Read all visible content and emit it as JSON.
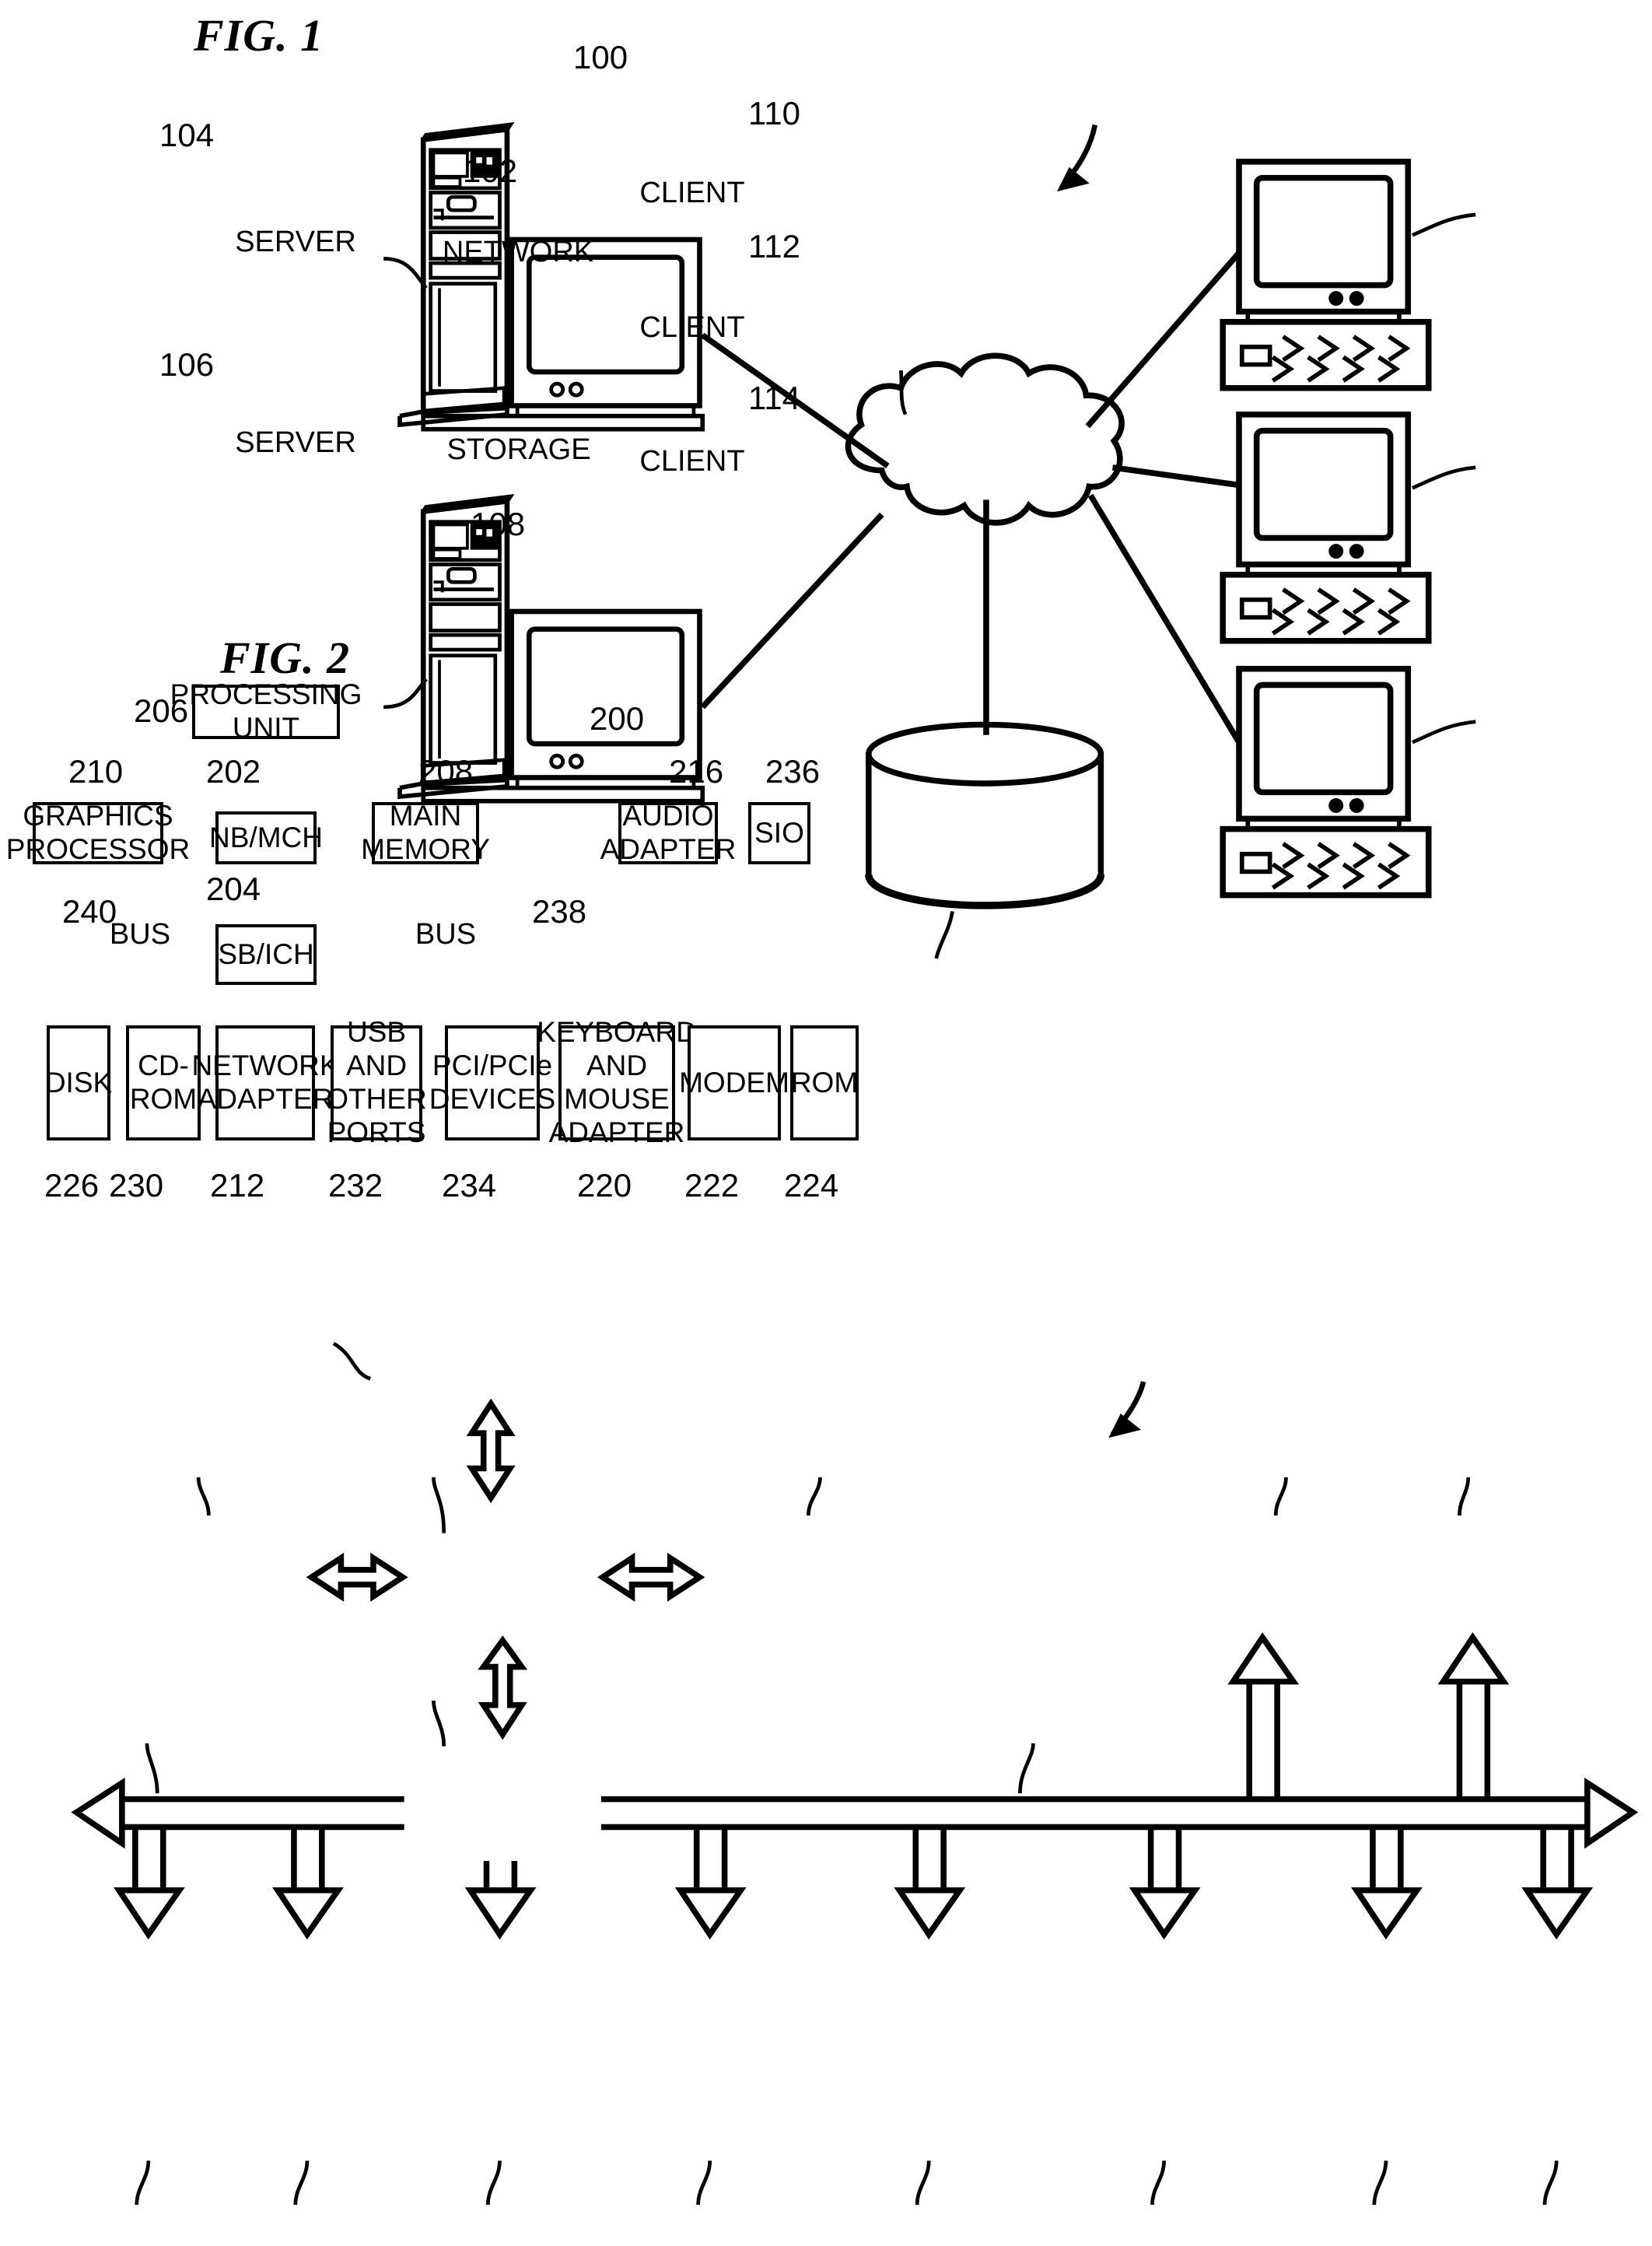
{
  "figures": [
    {
      "id": "fig1",
      "title": "FIG. 1",
      "system_ref": "100",
      "nodes": {
        "server_top": {
          "label": "SERVER",
          "ref": "104"
        },
        "server_bottom": {
          "label": "SERVER",
          "ref": "106"
        },
        "network": {
          "label": "NETWORK",
          "ref": "102"
        },
        "storage": {
          "label": "STORAGE",
          "ref": "108"
        },
        "client_1": {
          "label": "CLIENT",
          "ref": "110"
        },
        "client_2": {
          "label": "CLIENT",
          "ref": "112"
        },
        "client_3": {
          "label": "CLIENT",
          "ref": "114"
        }
      }
    },
    {
      "id": "fig2",
      "title": "FIG. 2",
      "system_ref": "200",
      "bus_left_label": "BUS",
      "bus_left_ref": "240",
      "bus_right_label": "BUS",
      "bus_right_ref": "238",
      "blocks": {
        "processing_unit": {
          "label": "PROCESSING\nUNIT",
          "ref": "206"
        },
        "graphics_processor": {
          "label": "GRAPHICS\nPROCESSOR",
          "ref": "210"
        },
        "nb_mch": {
          "label": "NB/MCH",
          "ref": "202"
        },
        "main_memory": {
          "label": "MAIN\nMEMORY",
          "ref": "208"
        },
        "audio_adapter": {
          "label": "AUDIO\nADAPTER",
          "ref": "216"
        },
        "sio": {
          "label": "SIO",
          "ref": "236"
        },
        "sb_ich": {
          "label": "SB/ICH",
          "ref": "204"
        },
        "disk": {
          "label": "DISK",
          "ref": "226"
        },
        "cdrom": {
          "label": "CD-ROM",
          "ref": "230"
        },
        "network_adapter": {
          "label": "NETWORK\nADAPTER",
          "ref": "212"
        },
        "usb_ports": {
          "label": "USB AND\nOTHER\nPORTS",
          "ref": "232"
        },
        "pci_devices": {
          "label": "PCI/PCIe\nDEVICES",
          "ref": "234"
        },
        "keyboard_mouse_adapter": {
          "label": "KEYBOARD\nAND\nMOUSE\nADAPTER",
          "ref": "220"
        },
        "modem": {
          "label": "MODEM",
          "ref": "222"
        },
        "rom": {
          "label": "ROM",
          "ref": "224"
        }
      }
    }
  ],
  "colors": {
    "ink": "#000000",
    "paper": "#ffffff"
  }
}
